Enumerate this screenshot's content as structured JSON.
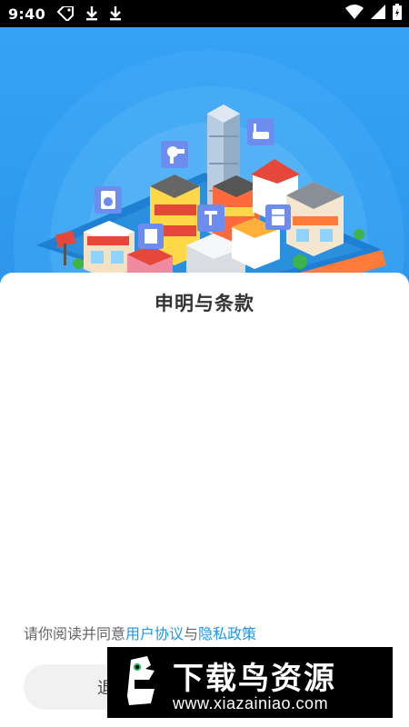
{
  "status_bar": {
    "time": "9:40",
    "icons": [
      "tag-icon",
      "download-icon",
      "download-icon",
      "wifi-icon",
      "signal-icon",
      "battery-icon"
    ]
  },
  "dialog": {
    "title": "申明与条款",
    "agreement_prefix": "请你阅读并同意",
    "user_agreement_link": "用户协议",
    "connector": "与",
    "privacy_policy_link": "隐私政策",
    "exit_button": "退"
  },
  "watermark": {
    "title": "下载鸟资源",
    "url": "www.xiazainiao.com"
  },
  "colors": {
    "hero_blue": "#2f9df0",
    "link_blue": "#1e96e8"
  }
}
